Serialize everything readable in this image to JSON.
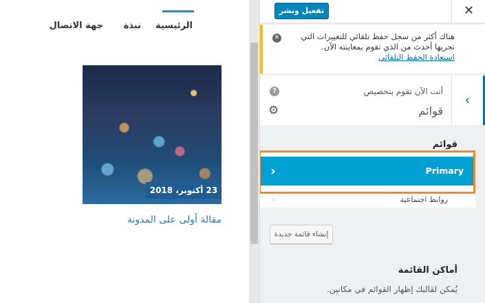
{
  "preview": {
    "nav": [
      {
        "label": "الرئيسية",
        "active": true
      },
      {
        "label": "نبذة",
        "active": false
      },
      {
        "label": "جهة الاتصال",
        "active": false
      }
    ],
    "post": {
      "date": "23 أكتوبر، 2018",
      "title": "مقالة أولى على المدونة"
    }
  },
  "panel": {
    "publish_label": "تفعيل ونشر",
    "close_icon": "close-icon",
    "notice": {
      "text": "هناك أكثر من سجل حفظ تلقائي للتغييرات التي تجريها أحدث من الذي تقوم بمعاينته الآن.",
      "link": "استعادة الحفظ التلقائي"
    },
    "section": {
      "caption": "أنت الآن تقوم بتخصيص",
      "title": "قوائم"
    },
    "menus_label": "قوائم",
    "menus": [
      {
        "label": "Primary"
      },
      {
        "label": "روابط اجتماعية"
      }
    ],
    "create_button": "إنشاء قائمة جديدة",
    "locations": {
      "title": "أماكن القائمة",
      "description": "يُمكن لقالبك إظهار القوائم في مكانين."
    },
    "colors": {
      "accent": "#0073aa",
      "highlight": "#00a0d2",
      "focus_outline": "#f18a2d",
      "notice_border": "#ffb900"
    }
  }
}
